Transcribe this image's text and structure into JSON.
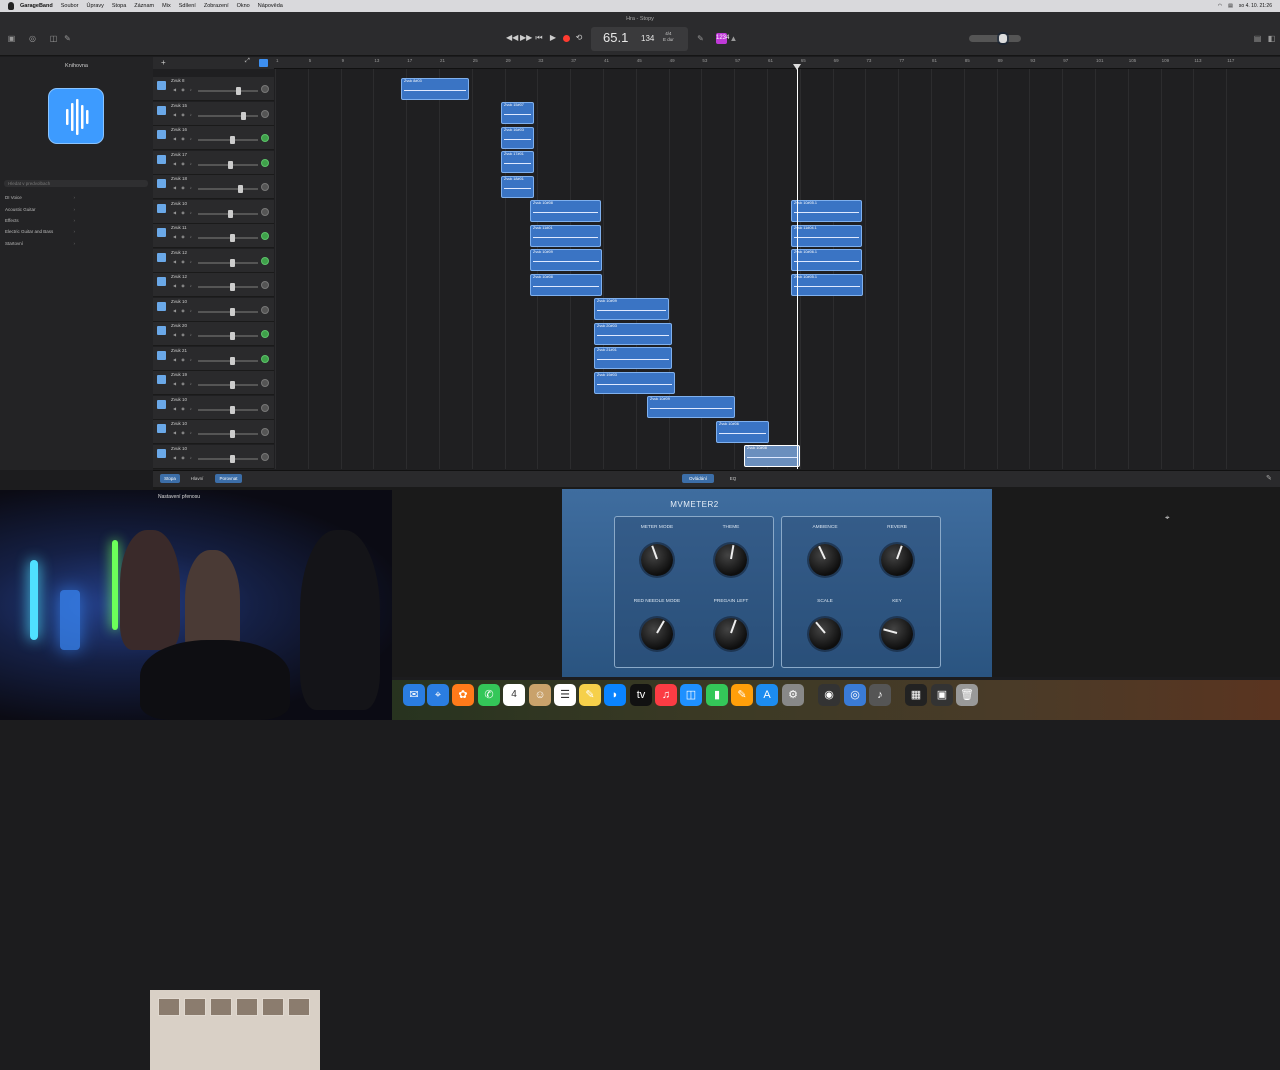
{
  "menubar": {
    "app": "GarageBand",
    "items": [
      "Soubor",
      "Úpravy",
      "Stopa",
      "Záznam",
      "Mix",
      "Sdílení",
      "Zobrazení",
      "Okno",
      "Nápověda"
    ],
    "clock": "so 4. 10. 21:26"
  },
  "window": {
    "title": "Hra - Stopy"
  },
  "lcd": {
    "position": "65.1",
    "tempo": "134",
    "time_sig": "4/4",
    "key": "E dur"
  },
  "library": {
    "title": "Knihovna",
    "search_placeholder": "Hledat v predvolbach",
    "items": [
      "DI Voice",
      "Acoustic Guitar",
      "Effects",
      "Electric Guitar and Bass",
      "Startovní"
    ]
  },
  "ruler": [
    "1",
    "5",
    "9",
    "13",
    "17",
    "21",
    "25",
    "29",
    "33",
    "37",
    "41",
    "45",
    "49",
    "53",
    "57",
    "61",
    "65",
    "69",
    "73",
    "77",
    "81",
    "85",
    "89",
    "93",
    "97",
    "101",
    "105",
    "109",
    "113",
    "117"
  ],
  "tracks": [
    {
      "name": "Zvuk 8",
      "pan": "grey"
    },
    {
      "name": "Zvuk 15",
      "pan": "grey"
    },
    {
      "name": "Zvuk 16",
      "pan": "green"
    },
    {
      "name": "Zvuk 17",
      "pan": "green"
    },
    {
      "name": "Zvuk 18",
      "pan": "grey"
    },
    {
      "name": "Zvuk 10",
      "pan": "grey"
    },
    {
      "name": "Zvuk 11",
      "pan": "green"
    },
    {
      "name": "Zvuk 12",
      "pan": "green"
    },
    {
      "name": "Zvuk 12",
      "pan": "grey"
    },
    {
      "name": "Zvuk 10",
      "pan": "grey"
    },
    {
      "name": "Zvuk 20",
      "pan": "green"
    },
    {
      "name": "Zvuk 21",
      "pan": "green"
    },
    {
      "name": "Zvuk 19",
      "pan": "grey"
    },
    {
      "name": "Zvuk 10",
      "pan": "grey"
    },
    {
      "name": "Zvuk 10",
      "pan": "grey"
    },
    {
      "name": "Zvuk 10",
      "pan": "grey"
    }
  ],
  "regions": [
    "Zvuk 8#03",
    "Zvuk 15#07",
    "Zvuk 16#03",
    "Zvuk 17#01",
    "Zvuk 18#01",
    "Zvuk 10#08",
    "Zvuk 11#01",
    "Zvuk 10#09",
    "Zvuk 10#08",
    "Zvuk 10#09",
    "Zvuk 20#03",
    "Zvuk 21#01",
    "Zvuk 19#03",
    "Zvuk 10#09",
    "Zvuk 10#06",
    "Zvuk 10#08",
    "Zvuk 10#05.1",
    "Zvuk 11#04.1",
    "Zvuk 10#06.1",
    "Zvuk 10#05.1"
  ],
  "editbar": {
    "tabs": [
      "Stopa",
      "Hlavní",
      "Porovnat"
    ],
    "center": [
      "Ovládání",
      "EQ"
    ],
    "sublabel": "Nastavení přenosu"
  },
  "plugin": {
    "title": "MVMETER2",
    "knobs": [
      "METER MODE",
      "THEME",
      "AMBIENCE",
      "REVERB",
      "RED NEEDLE MODE",
      "PREGAIN LEFT",
      "SCALE",
      "KEY"
    ]
  },
  "dock": {
    "calendar_day": "4"
  }
}
